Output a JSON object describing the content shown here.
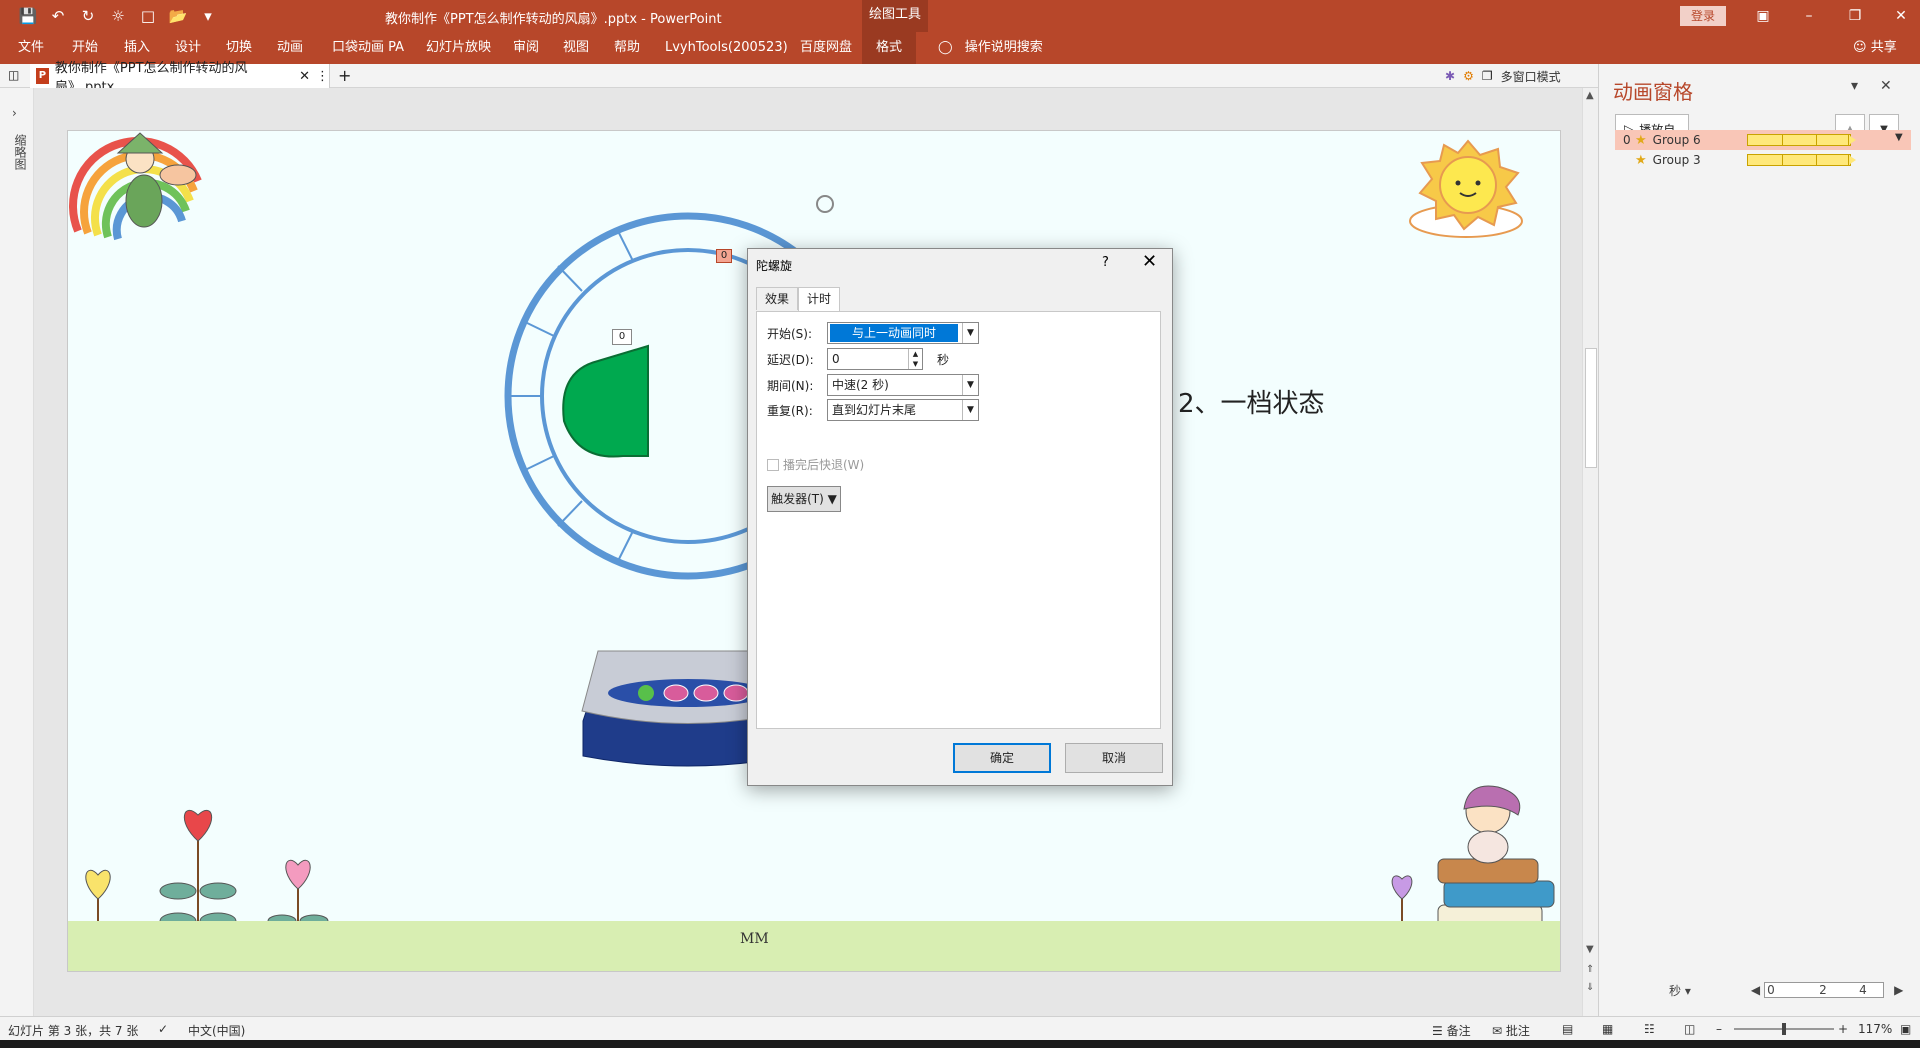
{
  "window": {
    "title": "教你制作《PPT怎么制作转动的风扇》.pptx  -  PowerPoint",
    "contextual_tab": "绘图工具",
    "login": "登录"
  },
  "ribbon": {
    "tabs": [
      "文件",
      "开始",
      "插入",
      "设计",
      "切换",
      "动画",
      "口袋动画 PA",
      "幻灯片放映",
      "审阅",
      "视图",
      "帮助",
      "LvyhTools(200523)",
      "百度网盘",
      "格式"
    ],
    "tell_me": "操作说明搜索",
    "share": "共享"
  },
  "doc_tab": {
    "name": "教你制作《PPT怎么制作转动的风扇》.pptx",
    "multi_window": "多窗口模式"
  },
  "left_strip": {
    "label": "缩略图"
  },
  "slide": {
    "caption": "2、一档状态",
    "tag_top": "0",
    "tag_left": "0",
    "signature": "MM"
  },
  "dialog": {
    "title": "陀螺旋",
    "help": "?",
    "tabs": [
      "效果",
      "计时"
    ],
    "fields": {
      "start_label": "开始(S):",
      "start_value": "与上一动画同时",
      "delay_label": "延迟(D):",
      "delay_value": "0",
      "delay_unit": "秒",
      "duration_label": "期间(N):",
      "duration_value": "中速(2 秒)",
      "repeat_label": "重复(R):",
      "repeat_value": "直到幻灯片末尾",
      "rewind_label": "播完后快退(W)"
    },
    "trigger": "触发器(T)",
    "ok": "确定",
    "cancel": "取消"
  },
  "animation_pane": {
    "title": "动画窗格",
    "play_from": "播放自",
    "items": [
      {
        "index": "0",
        "name": "Group 6"
      },
      {
        "index": "",
        "name": "Group 3"
      }
    ],
    "timeline_unit": "秒",
    "timeline_ticks": [
      "0",
      "2",
      "4"
    ]
  },
  "statusbar": {
    "slide_info": "幻灯片 第 3 张，共 7 张",
    "language": "中文(中国)",
    "notes": "备注",
    "comments": "批注",
    "zoom": "117%"
  },
  "colors": {
    "accent": "#b7472a",
    "selection": "#0078d7",
    "fan_blade": "#00a94f",
    "fan_ring": "#5b97d5"
  }
}
